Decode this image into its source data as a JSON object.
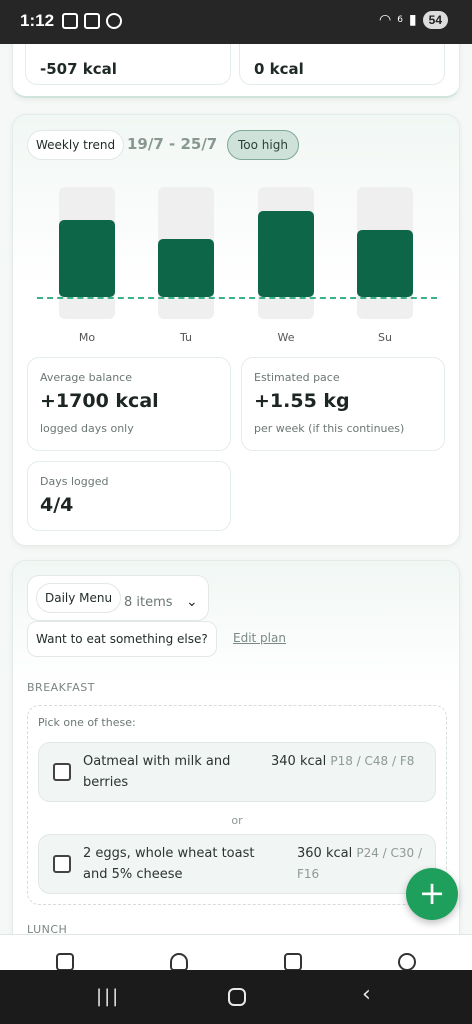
{
  "status_bar": {
    "time": "1:12",
    "battery": "54",
    "signal_label": "6"
  },
  "top_card": {
    "left_value": "-507 kcal",
    "right_value": "0 kcal"
  },
  "trend": {
    "label": "Weekly trend",
    "date_range": "19/7 - 25/7",
    "status": "Too high",
    "chart_data": {
      "type": "bar",
      "categories": [
        "Mo",
        "Tu",
        "We",
        "Su"
      ],
      "values": [
        0.7,
        0.53,
        0.78,
        0.61
      ],
      "target_fraction": 0.4
    },
    "stats": {
      "avg_label": "Average balance",
      "avg_value": "+1700 kcal",
      "avg_note": "logged days only",
      "pace_label": "Estimated pace",
      "pace_value": "+1.55 kg",
      "pace_note": "per week (if this continues)",
      "days_label": "Days logged",
      "days_value": "4/4"
    }
  },
  "menu": {
    "daily_menu_label": "Daily Menu",
    "items_count": "8 items",
    "other_prompt": "Want to eat something else?",
    "edit_plan": "Edit plan",
    "breakfast_header": "BREAKFAST",
    "pick_one": "Pick one of these:",
    "or_label": "or",
    "options": [
      {
        "name": "Oatmeal with milk and berries",
        "kcal": "340 kcal",
        "macros": "P18 / C48 / F8"
      },
      {
        "name": "2 eggs, whole wheat toast and 5% cheese",
        "kcal": "360 kcal",
        "macros": "P24 / C30 / F16"
      }
    ],
    "lunch_header": "LUNCH"
  },
  "fab_label": "+"
}
